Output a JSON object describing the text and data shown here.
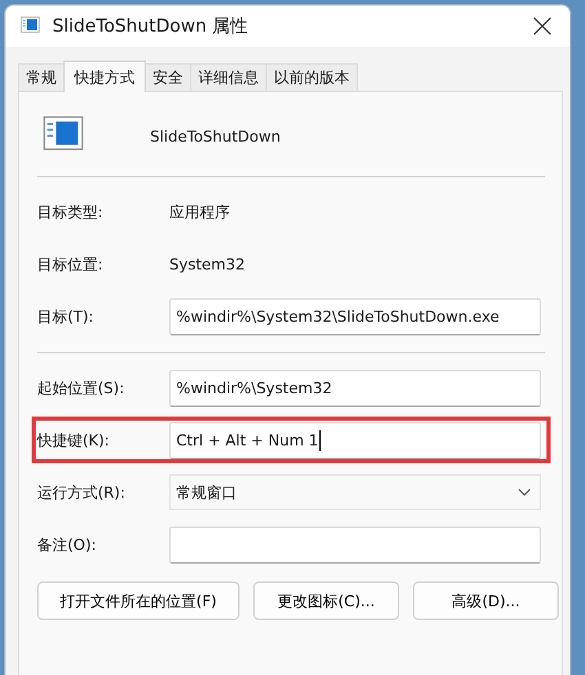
{
  "window": {
    "title": "SlideToShutDown 属性"
  },
  "tabs": [
    {
      "label": "常规",
      "selected": false
    },
    {
      "label": "快捷方式",
      "selected": true
    },
    {
      "label": "安全",
      "selected": false
    },
    {
      "label": "详细信息",
      "selected": false
    },
    {
      "label": "以前的版本",
      "selected": false
    }
  ],
  "shortcut": {
    "name": "SlideToShutDown"
  },
  "sections": [
    [
      {
        "kind": "text",
        "label": "目标类型:",
        "value": "应用程序",
        "highlighted": false
      },
      {
        "kind": "text",
        "label": "目标位置:",
        "value": "System32",
        "highlighted": false
      },
      {
        "kind": "input",
        "label": "目标(T):",
        "value": "%windir%\\System32\\SlideToShutDown.exe",
        "focused": false,
        "highlighted": false
      }
    ],
    [
      {
        "kind": "input",
        "label": "起始位置(S):",
        "value": "%windir%\\System32",
        "focused": false,
        "highlighted": false
      },
      {
        "kind": "input",
        "label": "快捷键(K):",
        "value": "Ctrl + Alt + Num 1",
        "focused": true,
        "highlighted": true
      },
      {
        "kind": "dropdown",
        "label": "运行方式(R):",
        "value": "常规窗口",
        "highlighted": false
      },
      {
        "kind": "input",
        "label": "备注(O):",
        "focused": false,
        "highlighted": false
      }
    ]
  ],
  "buttons": [
    "打开文件所在的位置(F)",
    "更改图标(C)...",
    "高级(D)..."
  ]
}
